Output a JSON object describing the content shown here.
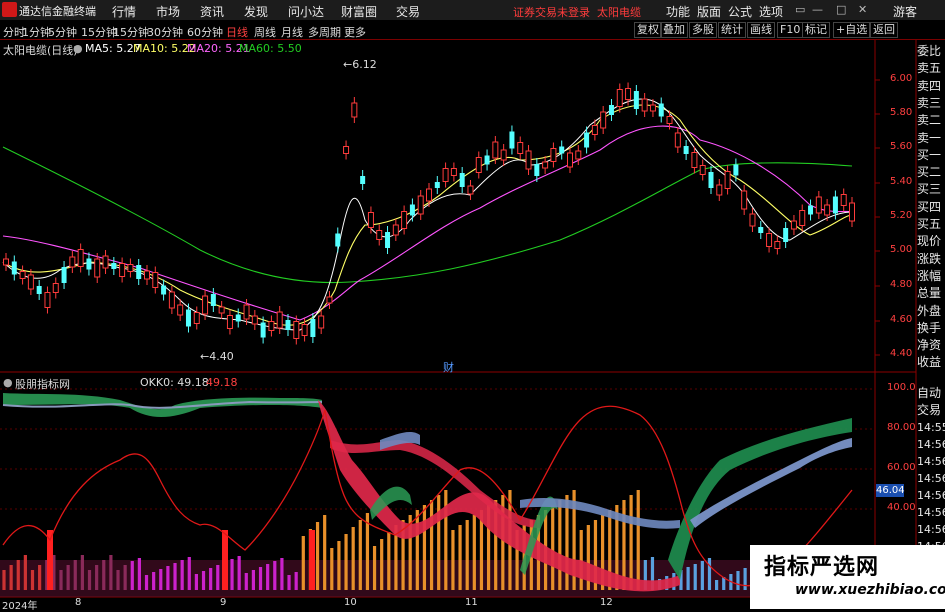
{
  "app": {
    "name": "通达信金融终端",
    "warning": "证券交易未登录",
    "stock": "太阳电缆"
  },
  "top_menu": [
    "行情",
    "市场",
    "资讯",
    "发现",
    "问小达",
    "财富圈",
    "交易"
  ],
  "right_menu": [
    "功能",
    "版面",
    "公式",
    "选项"
  ],
  "window_buttons": [
    "▭",
    "—",
    "□",
    "✕"
  ],
  "guest": "游客",
  "period_tabs": [
    "分时",
    "1分钟",
    "5分钟",
    "15分钟",
    "30分钟",
    "60分钟",
    "日线",
    "周线",
    "月线",
    "多周期",
    "更多"
  ],
  "active_period": "日线",
  "right_tools": [
    "复权",
    "叠加",
    "多股",
    "统计",
    "画线",
    "F10",
    "标记",
    "+自选",
    "返回"
  ],
  "price_legend": {
    "title": "太阳电缆(日线)",
    "ma5": "MA5: 5.27",
    "ma10": "MA10: 5.22",
    "ma20": "MA20: 5.21",
    "ma60": "MA60: 5.50"
  },
  "indicator_legend": {
    "title": "股朋指标网",
    "okk": "OKK0: 49.18",
    "okk2": "49.18"
  },
  "price_axis": [
    "6.00",
    "5.80",
    "5.60",
    "5.40",
    "5.20",
    "5.00",
    "4.80",
    "4.60",
    "4.40"
  ],
  "indicator_axis": [
    "100.0",
    "80.00",
    "60.00",
    "40.00"
  ],
  "indicator_badge": "46.04",
  "annotations": {
    "high": "6.12",
    "low": "4.40",
    "cai": "财"
  },
  "time_axis": [
    "2024年",
    "8",
    "9",
    "10",
    "11",
    "12"
  ],
  "side_panel": [
    "委比",
    "卖五",
    "卖四",
    "卖三",
    "卖二",
    "卖一",
    "买一",
    "买二",
    "买三",
    "买四",
    "买五",
    "现价",
    "涨跌",
    "涨幅",
    "总量",
    "外盘",
    "换手",
    "净资",
    "收益"
  ],
  "auto_trade": [
    "自动",
    "交易"
  ],
  "trade_times": [
    "14:55",
    "14:56",
    "14:56",
    "14:56",
    "14:56",
    "14:56",
    "14:56",
    "14:56",
    "14:56"
  ],
  "watermark": {
    "cn": "指标严选网",
    "url": "www.xuezhibiao.com"
  },
  "colors": {
    "up": "#ff3c3c",
    "down": "#55ffff",
    "ma5": "#ffffff",
    "ma10": "#ffff66",
    "ma20": "#ff66ff",
    "ma60": "#22cc22"
  }
}
